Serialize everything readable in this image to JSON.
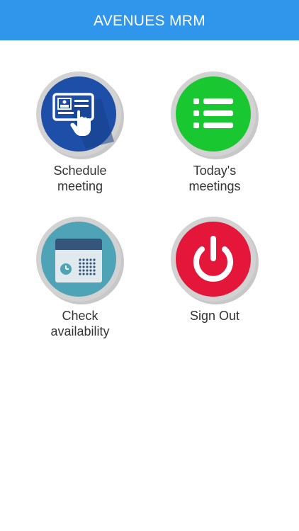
{
  "header": {
    "title": "AVENUES MRM",
    "color": "#2f96ec"
  },
  "tiles": [
    {
      "label": "Schedule\nmeeting",
      "icon": "schedule-meeting-icon",
      "color": "#1e4fa8"
    },
    {
      "label": "Today's\nmeetings",
      "icon": "list-icon",
      "color": "#19c830"
    },
    {
      "label": "Check\navailability",
      "icon": "calendar-clock-icon",
      "color": "#4fa3b6"
    },
    {
      "label": "Sign Out",
      "icon": "power-icon",
      "color": "#e4173a"
    }
  ]
}
